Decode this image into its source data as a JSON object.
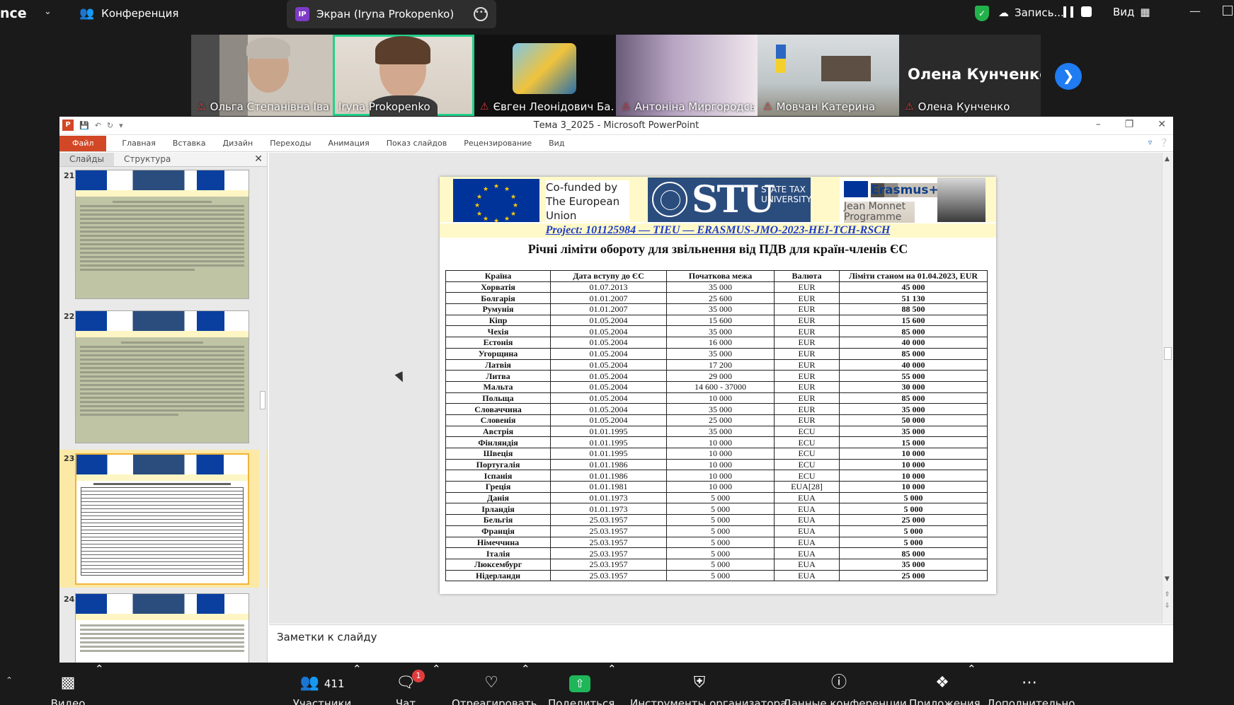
{
  "zoom": {
    "app_fragment": "nce",
    "conference_label": "Конференция",
    "screen_label": "Экран (Iryna Prokopenko)",
    "screen_avatar": "IP",
    "record_label": "Запись...",
    "view_label": "Вид",
    "participants": [
      {
        "name": "Ольга Степанівна Іван...",
        "muted": true
      },
      {
        "name": "Iryna Prokopenko",
        "muted": false,
        "active": true
      },
      {
        "name": "Євген Леонідович Ба...",
        "muted": true
      },
      {
        "name": "Антоніна Миргородсь...",
        "muted": true
      },
      {
        "name": "Мовчан Катерина",
        "muted": true
      },
      {
        "name": "Олена Кунченко",
        "muted": true,
        "big_name": "Олена Кунченко"
      }
    ],
    "toolbar": {
      "video": "Видео",
      "participants": "Участники",
      "participants_count": "411",
      "chat": "Чат",
      "chat_badge": "1",
      "react": "Отреагировать",
      "share": "Поделиться",
      "host_tools": "Инструменты организатора",
      "meeting_info": "Данные конференции",
      "apps": "Приложения",
      "more": "Дополнительно"
    }
  },
  "ppt": {
    "window_title": "Тема 3_2025  -  Microsoft PowerPoint",
    "ribbon": {
      "file": "Файл",
      "tabs": [
        "Главная",
        "Вставка",
        "Дизайн",
        "Переходы",
        "Анимация",
        "Показ слайдов",
        "Рецензирование",
        "Вид"
      ]
    },
    "panel_tabs": {
      "slides": "Слайды",
      "outline": "Структура"
    },
    "thumb_numbers": [
      "21",
      "22",
      "23",
      "24"
    ],
    "notes_placeholder": "Заметки к слайду",
    "slide": {
      "cofunded": "Co-funded by The European Union",
      "stu": "STU",
      "stu_sub": "STATE TAX UNIVERSITY",
      "erasmus": "Erasmus+",
      "jean_monnet": "Jean Monnet Programme",
      "project": "Project: 101125984 — TIEU — ERASMUS-JMO-2023-HEI-TCH-RSCH",
      "title": "Річні ліміти обороту для звільнення від ПДВ для країн-членів ЄС",
      "columns": [
        "Країна",
        "Дата вступу до ЄС",
        "Початкова межа",
        "Валюта",
        "Ліміти станом на 01.04.2023, EUR"
      ],
      "rows": [
        [
          "Хорватія",
          "01.07.2013",
          "35 000",
          "EUR",
          "45 000"
        ],
        [
          "Болгарія",
          "01.01.2007",
          "25 600",
          "EUR",
          "51 130"
        ],
        [
          "Румунія",
          "01.01.2007",
          "35 000",
          "EUR",
          "88 500"
        ],
        [
          "Кіпр",
          "01.05.2004",
          "15 600",
          "EUR",
          "15 600"
        ],
        [
          "Чехія",
          "01.05.2004",
          "35 000",
          "EUR",
          "85 000"
        ],
        [
          "Естонія",
          "01.05.2004",
          "16 000",
          "EUR",
          "40 000"
        ],
        [
          "Угорщина",
          "01.05.2004",
          "35 000",
          "EUR",
          "85 000"
        ],
        [
          "Латвія",
          "01.05.2004",
          "17 200",
          "EUR",
          "40 000"
        ],
        [
          "Литва",
          "01.05.2004",
          "29 000",
          "EUR",
          "55 000"
        ],
        [
          "Мальта",
          "01.05.2004",
          "14 600 - 37000",
          "EUR",
          "30 000"
        ],
        [
          "Польща",
          "01.05.2004",
          "10 000",
          "EUR",
          "85 000"
        ],
        [
          "Словаччина",
          "01.05.2004",
          "35 000",
          "EUR",
          "35 000"
        ],
        [
          "Словенія",
          "01.05.2004",
          "25 000",
          "EUR",
          "50 000"
        ],
        [
          "Австрія",
          "01.01.1995",
          "35 000",
          "ECU",
          "35 000"
        ],
        [
          "Фінляндія",
          "01.01.1995",
          "10 000",
          "ECU",
          "15 000"
        ],
        [
          "Швеція",
          "01.01.1995",
          "10 000",
          "ECU",
          "10 000"
        ],
        [
          "Португалія",
          "01.01.1986",
          "10 000",
          "ECU",
          "10 000"
        ],
        [
          "Іспанія",
          "01.01.1986",
          "10 000",
          "ECU",
          "10 000"
        ],
        [
          "Греція",
          "01.01.1981",
          "10 000",
          "EUA[28]",
          "10 000"
        ],
        [
          "Данія",
          "01.01.1973",
          "5 000",
          "EUA",
          "5 000"
        ],
        [
          "Ірландія",
          "01.01.1973",
          "5 000",
          "EUA",
          "5 000"
        ],
        [
          "Бельгія",
          "25.03.1957",
          "5 000",
          "EUA",
          "25 000"
        ],
        [
          "Франція",
          "25.03.1957",
          "5 000",
          "EUA",
          "5 000"
        ],
        [
          "Німеччина",
          "25.03.1957",
          "5 000",
          "EUA",
          "5 000"
        ],
        [
          "Італія",
          "25.03.1957",
          "5 000",
          "EUA",
          "85 000"
        ],
        [
          "Люксембург",
          "25.03.1957",
          "5 000",
          "EUA",
          "35 000"
        ],
        [
          "Нідерланди",
          "25.03.1957",
          "5 000",
          "EUA",
          "25 000"
        ]
      ]
    }
  }
}
